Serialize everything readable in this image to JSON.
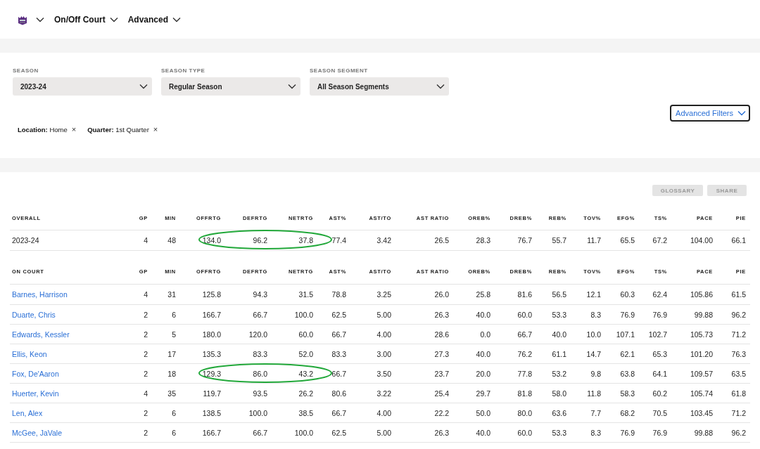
{
  "nav": {
    "items": [
      {
        "label": "On/Off Court"
      },
      {
        "label": "Advanced"
      }
    ]
  },
  "filters": [
    {
      "label": "SEASON",
      "value": "2023-24"
    },
    {
      "label": "SEASON TYPE",
      "value": "Regular Season"
    },
    {
      "label": "SEASON SEGMENT",
      "value": "All Season Segments"
    }
  ],
  "advanced_filters": {
    "label": "Advanced Filters"
  },
  "active_filters": [
    {
      "key": "Location:",
      "value": "Home",
      "remove": "×"
    },
    {
      "key": "Quarter:",
      "value": "1st Quarter",
      "remove": "×"
    }
  ],
  "buttons": [
    {
      "label": "GLOSSARY",
      "disabled": true
    },
    {
      "label": "SHARE",
      "disabled": true
    }
  ],
  "overall": {
    "columns": [
      "OVERALL",
      "GP",
      "MIN",
      "OFFRTG",
      "DEFRTG",
      "NETRTG",
      "AST%",
      "AST/TO",
      "AST RATIO",
      "OREB%",
      "DREB%",
      "REB%",
      "TOV%",
      "EFG%",
      "TS%",
      "PACE",
      "PIE"
    ],
    "rows": [
      {
        "name": "2023-24",
        "link": false,
        "circled": true,
        "values": [
          "4",
          "48",
          "134.0",
          "96.2",
          "37.8",
          "77.4",
          "3.42",
          "26.5",
          "28.3",
          "76.7",
          "55.7",
          "11.7",
          "65.5",
          "67.2",
          "104.00",
          "66.1"
        ]
      }
    ]
  },
  "on_court": {
    "columns": [
      "ON COURT",
      "GP",
      "MIN",
      "OFFRTG",
      "DEFRTG",
      "NETRTG",
      "AST%",
      "AST/TO",
      "AST RATIO",
      "OREB%",
      "DREB%",
      "REB%",
      "TOV%",
      "EFG%",
      "TS%",
      "PACE",
      "PIE"
    ],
    "rows": [
      {
        "name": "Barnes, Harrison",
        "link": true,
        "circled": false,
        "values": [
          "4",
          "31",
          "125.8",
          "94.3",
          "31.5",
          "78.8",
          "3.25",
          "26.0",
          "25.8",
          "81.6",
          "56.5",
          "12.1",
          "60.3",
          "62.4",
          "105.86",
          "61.5"
        ]
      },
      {
        "name": "Duarte, Chris",
        "link": true,
        "circled": false,
        "values": [
          "2",
          "6",
          "166.7",
          "66.7",
          "100.0",
          "62.5",
          "5.00",
          "26.3",
          "40.0",
          "60.0",
          "53.3",
          "8.3",
          "76.9",
          "76.9",
          "99.88",
          "96.2"
        ]
      },
      {
        "name": "Edwards, Kessler",
        "link": true,
        "circled": false,
        "values": [
          "2",
          "5",
          "180.0",
          "120.0",
          "60.0",
          "66.7",
          "4.00",
          "28.6",
          "0.0",
          "66.7",
          "40.0",
          "10.0",
          "107.1",
          "102.7",
          "105.73",
          "71.2"
        ]
      },
      {
        "name": "Ellis, Keon",
        "link": true,
        "circled": false,
        "values": [
          "2",
          "17",
          "135.3",
          "83.3",
          "52.0",
          "83.3",
          "3.00",
          "27.3",
          "40.0",
          "76.2",
          "61.1",
          "14.7",
          "62.1",
          "65.3",
          "101.20",
          "76.3"
        ]
      },
      {
        "name": "Fox, De'Aaron",
        "link": true,
        "circled": true,
        "values": [
          "2",
          "18",
          "129.3",
          "86.0",
          "43.2",
          "66.7",
          "3.50",
          "23.7",
          "20.0",
          "77.8",
          "53.2",
          "9.8",
          "63.8",
          "64.1",
          "109.57",
          "63.5"
        ]
      },
      {
        "name": "Huerter, Kevin",
        "link": true,
        "circled": false,
        "values": [
          "4",
          "35",
          "119.7",
          "93.5",
          "26.2",
          "80.6",
          "3.22",
          "25.4",
          "29.7",
          "81.8",
          "58.0",
          "11.8",
          "58.3",
          "60.2",
          "105.74",
          "61.8"
        ]
      },
      {
        "name": "Len, Alex",
        "link": true,
        "circled": false,
        "values": [
          "2",
          "6",
          "138.5",
          "100.0",
          "38.5",
          "66.7",
          "4.00",
          "22.2",
          "50.0",
          "80.0",
          "63.6",
          "7.7",
          "68.2",
          "70.5",
          "103.45",
          "71.2"
        ]
      },
      {
        "name": "McGee, JaVale",
        "link": true,
        "circled": false,
        "values": [
          "2",
          "6",
          "166.7",
          "66.7",
          "100.0",
          "62.5",
          "5.00",
          "26.3",
          "40.0",
          "60.0",
          "53.3",
          "8.3",
          "76.9",
          "76.9",
          "99.88",
          "96.2"
        ]
      }
    ]
  }
}
